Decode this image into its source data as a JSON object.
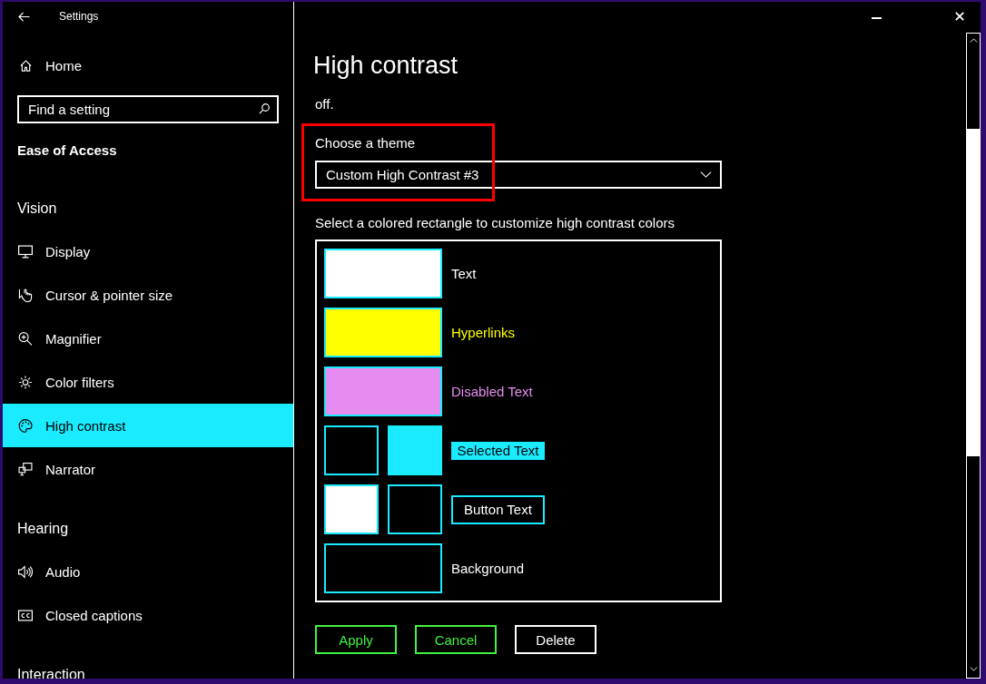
{
  "window": {
    "title": "Settings"
  },
  "sidebar": {
    "home": "Home",
    "search": {
      "placeholder": "Find a setting"
    },
    "section_title": "Ease of Access",
    "groups": [
      {
        "heading": "Vision",
        "items": [
          {
            "label": "Display",
            "selected": false
          },
          {
            "label": "Cursor & pointer size",
            "selected": false
          },
          {
            "label": "Magnifier",
            "selected": false
          },
          {
            "label": "Color filters",
            "selected": false
          },
          {
            "label": "High contrast",
            "selected": true
          },
          {
            "label": "Narrator",
            "selected": false
          }
        ]
      },
      {
        "heading": "Hearing",
        "items": [
          {
            "label": "Audio",
            "selected": false
          },
          {
            "label": "Closed captions",
            "selected": false
          }
        ]
      },
      {
        "heading": "Interaction"
      }
    ]
  },
  "page": {
    "title": "High contrast",
    "description": "off.",
    "theme": {
      "label": "Choose a theme",
      "value": "Custom High Contrast #3",
      "highlighted": true
    },
    "colors_hint": "Select a colored rectangle to customize high contrast colors",
    "color_rows": [
      {
        "label": "Text",
        "kind": "foreground",
        "swatches": [
          {
            "color": "#ffffff"
          }
        ]
      },
      {
        "label": "Hyperlinks",
        "kind": "foreground",
        "swatches": [
          {
            "color": "#ffff00"
          }
        ]
      },
      {
        "label": "Disabled Text",
        "kind": "foreground",
        "swatches": [
          {
            "color": "#e68cf0"
          }
        ]
      },
      {
        "label": "Selected Text",
        "kind": "selection",
        "swatches": [
          {
            "color": "#000000"
          },
          {
            "color": "#1aebff"
          }
        ]
      },
      {
        "label": "Button Text",
        "kind": "button",
        "swatches": [
          {
            "color": "#ffffff"
          },
          {
            "color": "#000000"
          }
        ]
      },
      {
        "label": "Background",
        "kind": "background",
        "swatches": [
          {
            "color": "#000000"
          }
        ]
      }
    ],
    "buttons": [
      {
        "label": "Apply",
        "disabled": true
      },
      {
        "label": "Cancel",
        "disabled": true
      },
      {
        "label": "Delete",
        "disabled": false
      }
    ]
  }
}
